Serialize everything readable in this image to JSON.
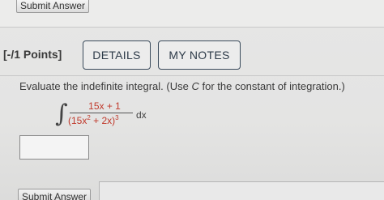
{
  "header": {
    "submit_label": "Submit Answer"
  },
  "question": {
    "points": "[-/1 Points]",
    "tabs": [
      {
        "label": "DETAILS"
      },
      {
        "label": "MY NOTES"
      }
    ],
    "prompt_before_c": "Evaluate the indefinite integral. (Use ",
    "prompt_c": "C",
    "prompt_after_c": " for the constant of integration.)",
    "integral_sign": "∫",
    "numerator": "15x + 1",
    "denominator_base": "(15x",
    "denominator_exp_inner": "2",
    "denominator_mid": " + 2x)",
    "denominator_exp_outer": "3",
    "differential": "dx"
  },
  "footer": {
    "submit_label": "Submit Answer"
  },
  "colors": {
    "accent_red": "#c0392b",
    "tab_border": "#3b4b5c"
  }
}
